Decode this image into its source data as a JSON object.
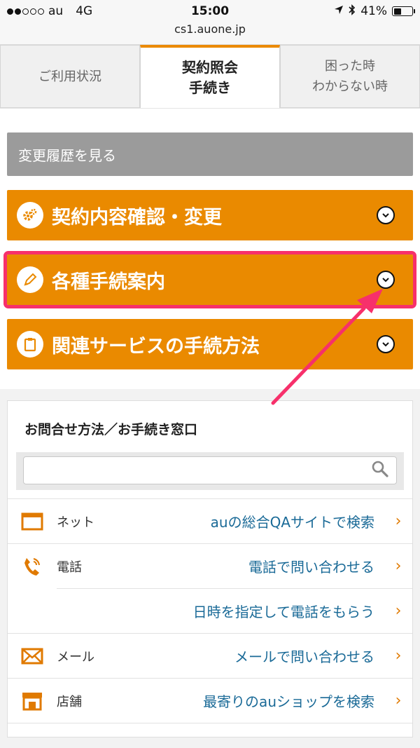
{
  "status": {
    "carrier": "au",
    "network": "4G",
    "time": "15:00",
    "battery": "41%"
  },
  "url": "cs1.auone.jp",
  "tabs": [
    {
      "label": "ご利用状況"
    },
    {
      "label": "契約照会\n手続き"
    },
    {
      "label": "困った時\nわからない時"
    }
  ],
  "history_button": "変更履歴を見る",
  "menu": [
    {
      "label": "契約内容確認・変更"
    },
    {
      "label": "各種手続案内"
    },
    {
      "label": "関連サービスの手続方法"
    }
  ],
  "inquiry": {
    "title": "お問合せ方法／お手続き窓口",
    "search_value": "",
    "rows": [
      {
        "category": "ネット",
        "link": "auの総合QAサイトで検索"
      },
      {
        "category": "電話",
        "link": "電話で問い合わせる"
      },
      {
        "category": "",
        "link": "日時を指定して電話をもらう"
      },
      {
        "category": "メール",
        "link": "メールで問い合わせる"
      },
      {
        "category": "店舗",
        "link": "最寄りのauショップを検索"
      }
    ]
  },
  "colors": {
    "accent": "#ea8a00",
    "highlight": "#f7306b",
    "link": "#1a6a97",
    "gray_button": "#9b9b9b"
  }
}
